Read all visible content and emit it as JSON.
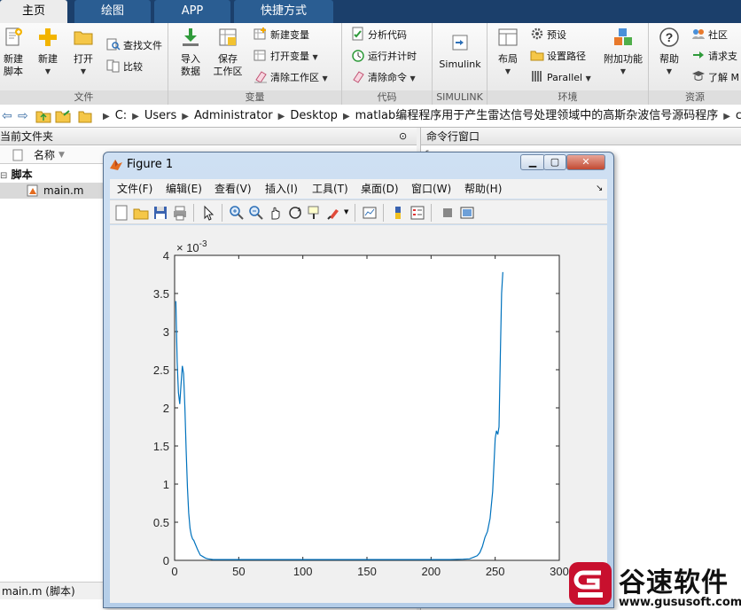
{
  "tabs": [
    {
      "label": "主页",
      "active": true
    },
    {
      "label": "绘图",
      "active": false
    },
    {
      "label": "APP",
      "active": false
    },
    {
      "label": "快捷方式",
      "active": false
    }
  ],
  "ribbon": {
    "file": {
      "label": "文件",
      "new_script": "新建\n脚本",
      "new": "新建",
      "open": "打开",
      "find_files": "查找文件",
      "compare": "比较"
    },
    "variable": {
      "label": "变量",
      "import_data": "导入\n数据",
      "save_workspace": "保存\n工作区",
      "new_variable": "新建变量",
      "open_variable": "打开变量",
      "clear_workspace": "清除工作区"
    },
    "code": {
      "label": "代码",
      "analyze_code": "分析代码",
      "run_and_time": "运行并计时",
      "clear_commands": "清除命令"
    },
    "simulink": {
      "label": "SIMULINK",
      "button": "Simulink"
    },
    "environment": {
      "label": "环境",
      "layout": "布局",
      "preferences": "预设",
      "set_path": "设置路径",
      "parallel": "Parallel",
      "addons": "附加功能"
    },
    "resources": {
      "label": "资源",
      "help": "帮助",
      "community": "社区",
      "request_support": "请求支",
      "learn": "了解 M"
    }
  },
  "address": {
    "crumbs": [
      "C:",
      "Users",
      "Administrator",
      "Desktop",
      "matlab编程程序用于产生雷达信号处理领域中的高斯杂波信号源码程序",
      "code"
    ]
  },
  "current_folder": {
    "title": "当前文件夹",
    "column_name": "名称",
    "group": "脚本",
    "files": [
      "main.m"
    ],
    "status": "main.m  (脚本)"
  },
  "command_window": {
    "title": "命令行窗口"
  },
  "figure": {
    "title": "Figure 1",
    "menus": [
      "文件(F)",
      "编辑(E)",
      "查看(V)",
      "插入(I)",
      "工具(T)",
      "桌面(D)",
      "窗口(W)",
      "帮助(H)"
    ]
  },
  "chart_data": {
    "type": "line",
    "title": "",
    "xlabel": "",
    "ylabel": "",
    "y_multiplier": "× 10^-3",
    "xlim": [
      0,
      300
    ],
    "ylim": [
      0,
      4
    ],
    "xticks": [
      0,
      50,
      100,
      150,
      200,
      250,
      300
    ],
    "yticks": [
      0,
      0.5,
      1,
      1.5,
      2,
      2.5,
      3,
      3.5,
      4
    ],
    "grid": false,
    "series": [
      {
        "color": "#0072BD",
        "x": [
          1,
          2,
          3,
          4,
          5,
          6,
          7,
          8,
          9,
          10,
          11,
          12,
          13,
          14,
          15,
          16,
          18,
          20,
          22,
          24,
          26,
          28,
          30,
          35,
          40,
          60,
          80,
          100,
          120,
          140,
          160,
          180,
          200,
          215,
          225,
          230,
          233,
          236,
          238,
          240,
          242,
          244,
          246,
          248,
          250,
          251,
          252,
          253,
          254,
          255,
          256
        ],
        "y": [
          3.4,
          2.6,
          2.2,
          2.05,
          2.3,
          2.55,
          2.45,
          2.0,
          1.45,
          0.95,
          0.62,
          0.42,
          0.33,
          0.28,
          0.26,
          0.22,
          0.14,
          0.07,
          0.05,
          0.03,
          0.02,
          0.015,
          0.01,
          0.01,
          0.01,
          0.01,
          0.01,
          0.01,
          0.01,
          0.01,
          0.01,
          0.01,
          0.01,
          0.01,
          0.015,
          0.02,
          0.04,
          0.06,
          0.1,
          0.18,
          0.3,
          0.38,
          0.55,
          0.9,
          1.6,
          1.7,
          1.65,
          1.75,
          2.7,
          3.5,
          3.78
        ]
      }
    ]
  },
  "watermark": {
    "brand": "谷速软件",
    "url": "www.gususoft.com"
  },
  "colors": {
    "tab_bar": "#1b3f6b",
    "plot_line": "#0072BD",
    "watermark_red": "#c8102e"
  }
}
